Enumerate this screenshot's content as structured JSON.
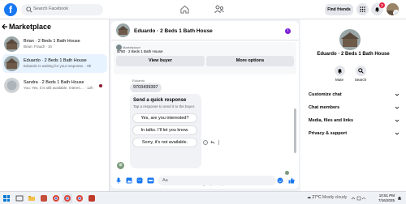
{
  "topbar": {
    "logo": "f",
    "search_placeholder": "Search Facebook",
    "find_friends": "Find friends",
    "notification_count": "2"
  },
  "left": {
    "title": "Marketplace",
    "conversations": [
      {
        "name": "Brian · 2 Beds 1 Bath House",
        "sub": "Brian: Fraud! · 1h"
      },
      {
        "name": "Eduardo · 2 Beds 1 Bath House",
        "sub": "Eduardo is waiting for your response. · 8h"
      },
      {
        "name": "Sandra · 2 Beds 1 Bath House",
        "sub": "You: Yes, it is still available. Interes… · 12h"
      }
    ]
  },
  "chat": {
    "title": "Eduardo · 2 Beds 1 Bath House",
    "more_badge": "i",
    "listing_label": "Marketplace",
    "listing_detail": "$750 · 2 Beds 1 Bath House",
    "view_buyer": "View buyer",
    "more_options": "More options",
    "sender": "Eduardo",
    "message": "9703439397",
    "quick_title": "Send a quick response",
    "quick_sub": "Tap a response to send it to the buyer.",
    "quick_replies": [
      "Yes, are you interested?",
      "In talks. I'll let you know.",
      "Sorry, it's not available."
    ],
    "waiting": "Eduardo is waiting for your response.",
    "composer_placeholder": "Aa"
  },
  "right": {
    "title": "Eduardo · 2 Beds 1 Bath House",
    "mute": "Mute",
    "search": "Search",
    "rows": [
      "Customize chat",
      "Chat members",
      "Media, files and links",
      "Privacy & support"
    ]
  },
  "taskbar": {
    "temperature": "27°C",
    "condition": "Mostly cloudy",
    "time": "10:51 PM",
    "date": "7/16/2025"
  },
  "colors": {
    "brand": "#1877f2",
    "active_conv": "#e7f3ff",
    "badge": "#e41e3f"
  }
}
